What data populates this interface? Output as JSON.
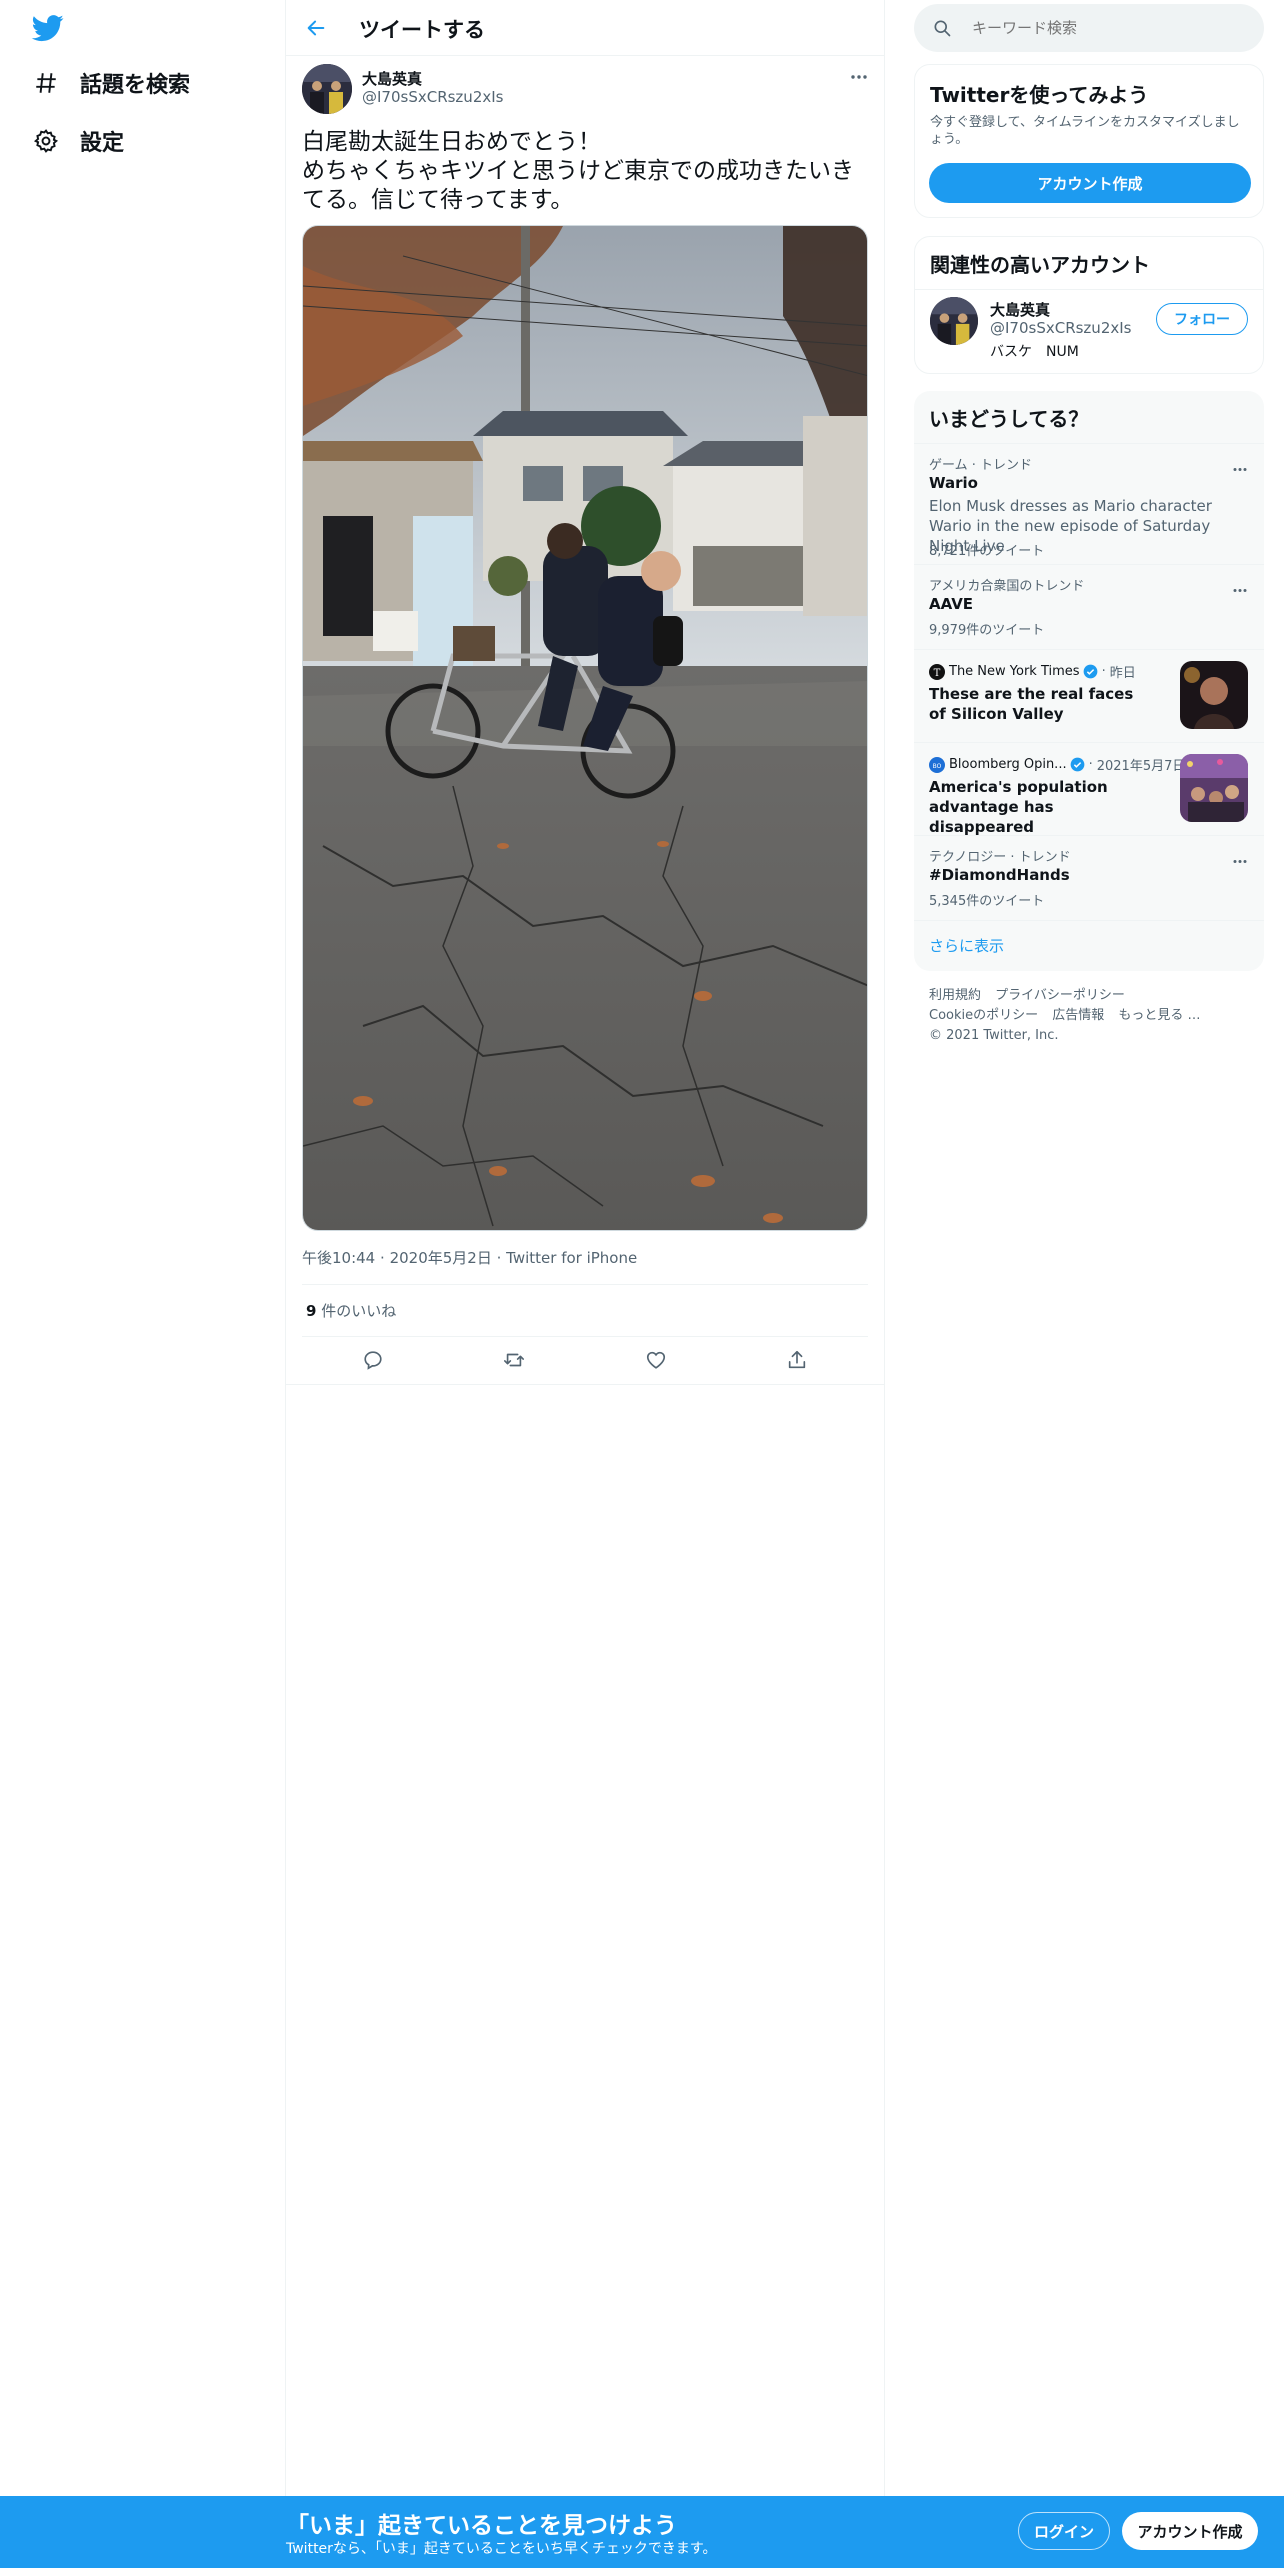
{
  "colors": {
    "accent": "#1d9bf0",
    "text": "#0f1419",
    "secondary": "#536471",
    "verified": "#1d9bf0"
  },
  "nav": {
    "logo_icon": "twitter-bird-icon",
    "items": [
      {
        "icon": "hashtag-icon",
        "label": "話題を検索"
      },
      {
        "icon": "gear-icon",
        "label": "設定"
      }
    ]
  },
  "header": {
    "back_icon": "arrow-left-icon",
    "title": "ツイートする"
  },
  "tweet": {
    "author_name": "大島英真",
    "author_handle": "@I70sSxCRszu2xIs",
    "text": "白尾勘太誕生日おめでとう！\nめちゃくちゃキツイと思うけど東京での成功きたいきてる。信じて待ってます。",
    "time": "午後10:44",
    "date": "2020年5月2日",
    "source": "Twitter for iPhone",
    "likes_count": "9",
    "likes_label": " 件のいいね",
    "action_icons": [
      "reply-icon",
      "retweet-icon",
      "like-icon",
      "share-icon"
    ]
  },
  "search": {
    "placeholder": "キーワード検索"
  },
  "signup_card": {
    "title": "Twitterを使ってみよう",
    "desc": "今すぐ登録して、タイムラインをカスタマイズしましょう。",
    "button": "アカウント作成"
  },
  "related": {
    "title": "関連性の高いアカウント",
    "name": "大島英真",
    "handle": "@I70sSxCRszu2xIs",
    "bio": "バスケ　NUM",
    "follow": "フォロー"
  },
  "trends": {
    "title": "いまどうしてる？",
    "items": [
      {
        "category": "ゲーム · トレンド",
        "name": "Wario",
        "desc": "Elon Musk dresses as Mario character Wario in the new episode of Saturday Night Live",
        "count": "8,721件のツイート"
      },
      {
        "category": "アメリカ合衆国のトレンド",
        "name": "AAVE",
        "count": "9,979件のツイート"
      },
      {
        "source": "The New York Times",
        "time": "昨日",
        "title": "These are the real faces of Silicon Valley"
      },
      {
        "source": "Bloomberg Opin...",
        "time": "2021年5月7日",
        "title": "America's population advantage has disappeared"
      },
      {
        "category": "テクノロジー · トレンド",
        "name": "#DiamondHands",
        "count": "5,345件のツイート"
      }
    ],
    "show_more": "さらに表示"
  },
  "footer": {
    "links": [
      "利用規約",
      "プライバシーポリシー",
      "Cookieのポリシー",
      "広告情報",
      "もっと見る …"
    ],
    "copyright": "© 2021 Twitter, Inc."
  },
  "bottom_bar": {
    "title": "「いま」起きていることを見つけよう",
    "subtitle": "Twitterなら、「いま」起きていることをいち早くチェックできます。",
    "login": "ログイン",
    "signup": "アカウント作成"
  }
}
